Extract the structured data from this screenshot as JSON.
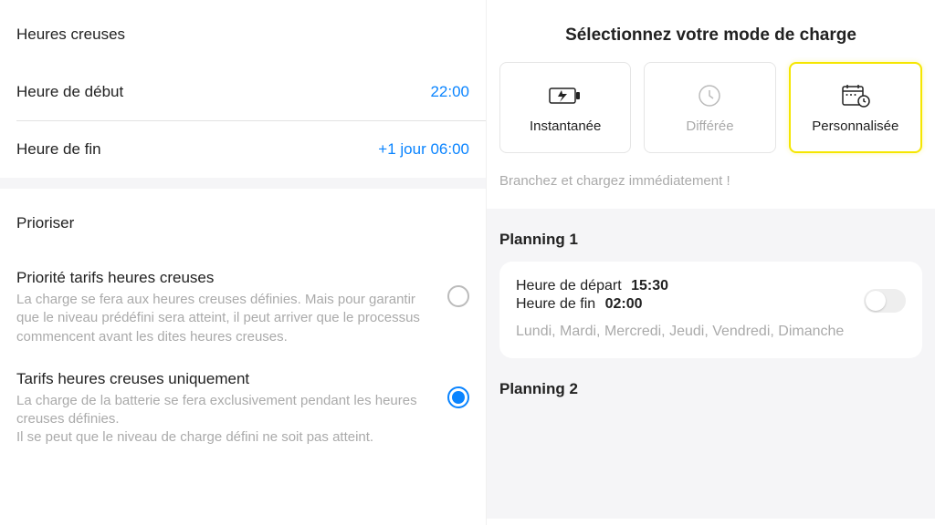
{
  "left": {
    "section1_title": "Heures creuses",
    "start_label": "Heure de début",
    "start_value": "22:00",
    "end_label": "Heure de fin",
    "end_value": "+1 jour 06:00",
    "section2_title": "Prioriser",
    "prio1_label": "Priorité tarifs heures creuses",
    "prio1_desc": "La charge se fera aux heures creuses définies. Mais pour garantir que le niveau prédéfini sera atteint, il peut arriver que le processus commencent avant les dites heures creuses.",
    "prio2_label": "Tarifs heures creuses uniquement",
    "prio2_desc": "La charge de la batterie se fera exclusivement pendant les heures creuses définies.\nIl se peut que le niveau de charge défini ne soit pas atteint."
  },
  "right": {
    "mode_title": "Sélectionnez votre mode de charge",
    "modes": {
      "instant": "Instantanée",
      "delayed": "Différée",
      "custom": "Personnalisée"
    },
    "mode_hint": "Branchez et chargez immédiatement !",
    "planning1_title": "Planning 1",
    "planning1_start_label": "Heure de départ",
    "planning1_start_value": "15:30",
    "planning1_end_label": "Heure de fin",
    "planning1_end_value": "02:00",
    "planning1_days": "Lundi, Mardi, Mercredi, Jeudi, Vendredi, Dimanche",
    "planning2_title": "Planning 2"
  }
}
